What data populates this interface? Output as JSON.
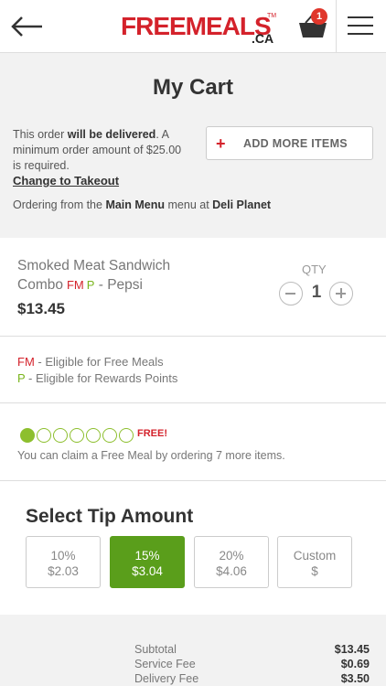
{
  "header": {
    "logo_main": "FREEMEALS",
    "logo_tm": "TM",
    "logo_ca": ".CA",
    "cart_count": "1"
  },
  "page": {
    "title": "My Cart",
    "order_note_pre": "This order ",
    "order_note_bold": "will be delivered",
    "order_note_post": ". A minimum order amount of $25.00 is required.",
    "change_link": "Change to Takeout",
    "add_more_plus": "+",
    "add_more_label": "ADD MORE ITEMS",
    "ordering_pre": "Ordering from the ",
    "ordering_menu": "Main Menu",
    "ordering_mid": " menu at ",
    "ordering_restaurant": "Deli Planet"
  },
  "item": {
    "name": "Smoked Meat Sandwich Combo",
    "fm": "FM",
    "p": "P",
    "option": "- Pepsi",
    "price": "$13.45",
    "qty_label": "QTY",
    "qty": "1"
  },
  "legend": {
    "fm": "FM",
    "fm_text": " - Eligible for Free Meals",
    "p": "P",
    "p_text": " - Eligible for Rewards Points"
  },
  "progress": {
    "filled": 1,
    "total": 7,
    "free_label": "FREE!",
    "text": "You can claim a Free Meal by ordering 7 more items."
  },
  "tips": {
    "title": "Select Tip Amount",
    "options": [
      {
        "pct": "10%",
        "amount": "$2.03",
        "selected": false
      },
      {
        "pct": "15%",
        "amount": "$3.04",
        "selected": true
      },
      {
        "pct": "20%",
        "amount": "$4.06",
        "selected": false
      },
      {
        "pct": "Custom",
        "amount": "$",
        "selected": false
      }
    ]
  },
  "summary": {
    "rows": [
      {
        "label": "Subtotal",
        "value": "$13.45"
      },
      {
        "label": "Service Fee",
        "value": "$0.69"
      },
      {
        "label": "Delivery Fee",
        "value": "$3.50"
      }
    ]
  },
  "colors": {
    "brand_red": "#d4222b",
    "green": "#5a9e1b",
    "rewards_green": "#7ab51d"
  }
}
